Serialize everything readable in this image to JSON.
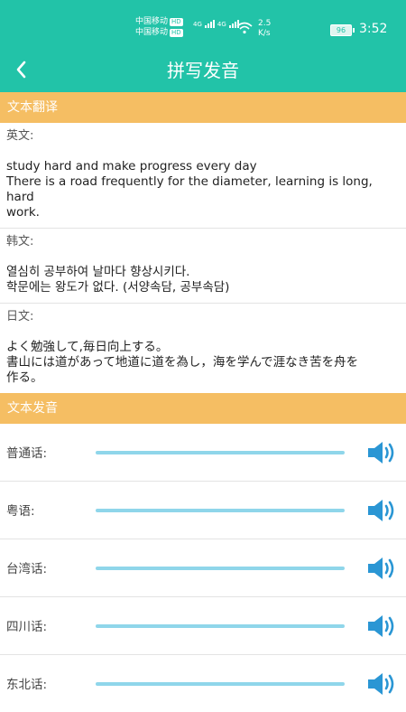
{
  "status_bar": {
    "carrier1": "中国移动",
    "carrier2": "中国移动",
    "hd_badge": "HD",
    "net_type": "4G",
    "speed_value": "2.5",
    "speed_unit": "K/s",
    "battery": "96",
    "time": "3:52"
  },
  "header": {
    "title": "拼写发音",
    "back_icon": "back-chevron-icon"
  },
  "translation": {
    "section_title": "文本翻译",
    "english": {
      "label": "英文:",
      "lines": [
        "study hard and make progress every day",
        "There is a road frequently for the diameter, learning is long, hard",
        "work."
      ]
    },
    "korean": {
      "label": "韩文:",
      "lines": [
        "열심히 공부하여 날마다 향상시키다.",
        "학문에는 왕도가 없다. (서양속담, 공부속담)"
      ]
    },
    "japanese": {
      "label": "日文:",
      "lines": [
        "よく勉強して,毎日向上する。",
        "書山には道があって地道に道を為し，海を学んで涯なき苦を舟を",
        "作る。"
      ]
    }
  },
  "pronunciation": {
    "section_title": "文本发音",
    "speaker_icon": "speaker-icon",
    "accent_color": "#2a96d4",
    "items": [
      {
        "label": "普通话:"
      },
      {
        "label": "粤语:"
      },
      {
        "label": "台湾话:"
      },
      {
        "label": "四川话:"
      },
      {
        "label": "东北话:"
      }
    ]
  },
  "colors": {
    "primary": "#22c3a8",
    "section": "#f5be63",
    "track": "#8fd6ea"
  }
}
